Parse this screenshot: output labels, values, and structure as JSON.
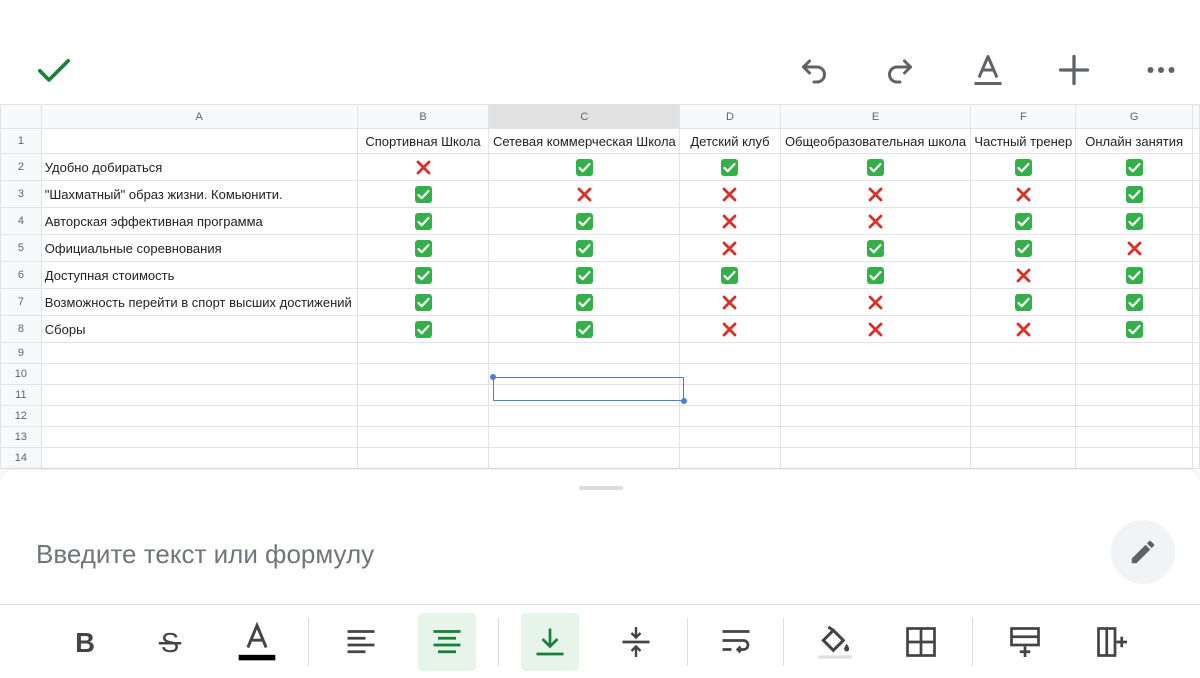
{
  "toolbar_top": {
    "confirm_icon": "check-icon",
    "undo_icon": "undo-icon",
    "redo_icon": "redo-icon",
    "text_format_icon": "text-format-icon",
    "insert_icon": "plus-icon",
    "more_icon": "more-horiz-icon"
  },
  "sheet": {
    "column_headers": [
      "A",
      "B",
      "C",
      "D",
      "E",
      "F",
      "G"
    ],
    "selected_column": "C",
    "selected_cell": "C11",
    "row_numbers": [
      "1",
      "2",
      "3",
      "4",
      "5",
      "6",
      "7",
      "8",
      "9",
      "10",
      "11",
      "12",
      "13",
      "14"
    ],
    "header_row": [
      "",
      "Спортивная Школа",
      "Сетевая коммерческая Школа",
      "Детский клуб",
      "Общеобразовательная школа",
      "Частный тренер",
      "Онлайн занятия"
    ],
    "rows": [
      {
        "label": "Удобно добираться",
        "marks": [
          "no",
          "yes",
          "yes",
          "yes",
          "yes",
          "yes"
        ]
      },
      {
        "label": "\"Шахматный\" образ жизни. Комьюнити.",
        "marks": [
          "yes",
          "no",
          "no",
          "no",
          "no",
          "yes"
        ]
      },
      {
        "label": "Авторская эффективная программа",
        "marks": [
          "yes",
          "yes",
          "no",
          "no",
          "yes",
          "yes"
        ]
      },
      {
        "label": "Официальные соревнования",
        "marks": [
          "yes",
          "yes",
          "no",
          "yes",
          "yes",
          "no"
        ]
      },
      {
        "label": "Доступная стоимость",
        "marks": [
          "yes",
          "yes",
          "yes",
          "yes",
          "no",
          "yes"
        ]
      },
      {
        "label": "Возможность перейти в спорт высших достижений",
        "marks": [
          "yes",
          "yes",
          "no",
          "no",
          "yes",
          "yes"
        ]
      },
      {
        "label": "Сборы",
        "marks": [
          "yes",
          "yes",
          "no",
          "no",
          "no",
          "yes"
        ]
      }
    ],
    "colors": {
      "check": "#33b04a",
      "cross": "#d93025",
      "selection": "#4a7fd6"
    }
  },
  "formula_bar": {
    "placeholder": "Введите текст или формулу",
    "edit_icon": "pencil-icon"
  },
  "format_toolbar": {
    "items": [
      {
        "icon": "bold-icon",
        "active": false
      },
      {
        "icon": "strikethrough-icon",
        "active": false
      },
      {
        "icon": "text-color-icon",
        "active": false
      },
      {
        "icon": "align-left-icon",
        "active": false
      },
      {
        "icon": "align-center-icon",
        "active": true
      },
      {
        "icon": "vertical-align-bottom-icon",
        "active": true
      },
      {
        "icon": "vertical-align-middle-icon",
        "active": false
      },
      {
        "icon": "text-wrap-icon",
        "active": false
      },
      {
        "icon": "fill-color-icon",
        "active": false
      },
      {
        "icon": "borders-icon",
        "active": false
      },
      {
        "icon": "insert-row-icon",
        "active": false
      },
      {
        "icon": "insert-column-icon",
        "active": false
      }
    ],
    "accent_color": "#188038",
    "active_bg": "#e6f4ea"
  }
}
